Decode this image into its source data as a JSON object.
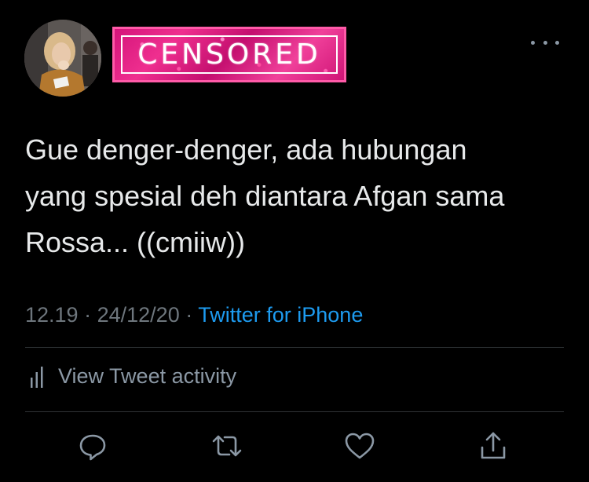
{
  "header": {
    "censor_label": "CENSORED"
  },
  "tweet": {
    "text": "Gue denger-denger, ada hubungan\nyang spesial deh diantara Afgan sama\nRossa... ((cmiiw))",
    "time": "12.19",
    "date": "24/12/20",
    "separator": "·",
    "source": "Twitter for iPhone"
  },
  "activity": {
    "label": "View Tweet activity"
  },
  "actions": {
    "icons": [
      "reply-icon",
      "retweet-icon",
      "like-icon",
      "share-icon"
    ]
  },
  "colors": {
    "background": "#000000",
    "text": "#e7e9ea",
    "muted": "#6e767d",
    "link": "#1d9bf0",
    "censor_pink": "#e0207f"
  }
}
